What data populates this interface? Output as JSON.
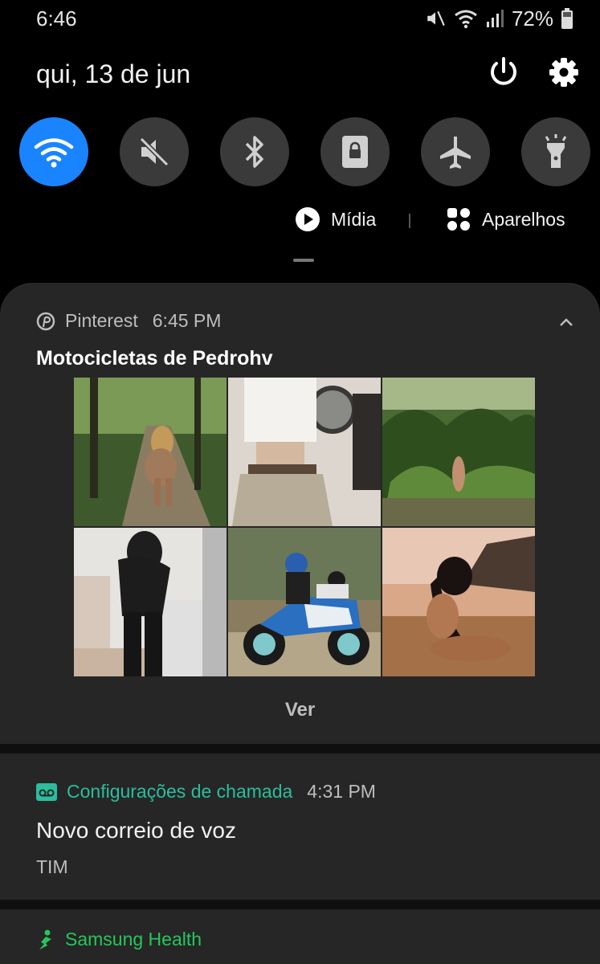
{
  "status_bar": {
    "time": "6:46",
    "battery_percent": "72%",
    "icons": [
      "mute-icon",
      "wifi-icon",
      "signal-icon",
      "battery-icon"
    ]
  },
  "quick_settings": {
    "date": "qui, 13 de jun",
    "tiles": [
      {
        "name": "wifi",
        "icon": "wifi-icon",
        "active": true
      },
      {
        "name": "sound",
        "icon": "mute-icon",
        "active": false
      },
      {
        "name": "bluetooth",
        "icon": "bluetooth-icon",
        "active": false
      },
      {
        "name": "rotation-lock",
        "icon": "lock-icon",
        "active": false
      },
      {
        "name": "airplane",
        "icon": "airplane-icon",
        "active": false
      },
      {
        "name": "flashlight",
        "icon": "flashlight-icon",
        "active": false
      }
    ],
    "media_label": "Mídia",
    "devices_label": "Aparelhos"
  },
  "notifications": {
    "pinterest": {
      "app": "Pinterest",
      "time": "6:45 PM",
      "title": "Motocicletas de Pedrohv",
      "images": [
        "forest-trail-photo",
        "mirror-selfie-photo",
        "jungle-photo",
        "black-outfit-selfie-photo",
        "motorcycle-photo",
        "beach-sunset-photo"
      ],
      "action": "Ver"
    },
    "voicemail": {
      "app": "Configurações de chamada",
      "time": "4:31 PM",
      "title": "Novo correio de voz",
      "subtitle": "TIM"
    },
    "health": {
      "app": "Samsung Health"
    }
  },
  "colors": {
    "accent_blue": "#1a84ff",
    "voicemail_teal": "#2bbd9e",
    "health_green": "#25c75b",
    "panel_bg": "#262626"
  }
}
